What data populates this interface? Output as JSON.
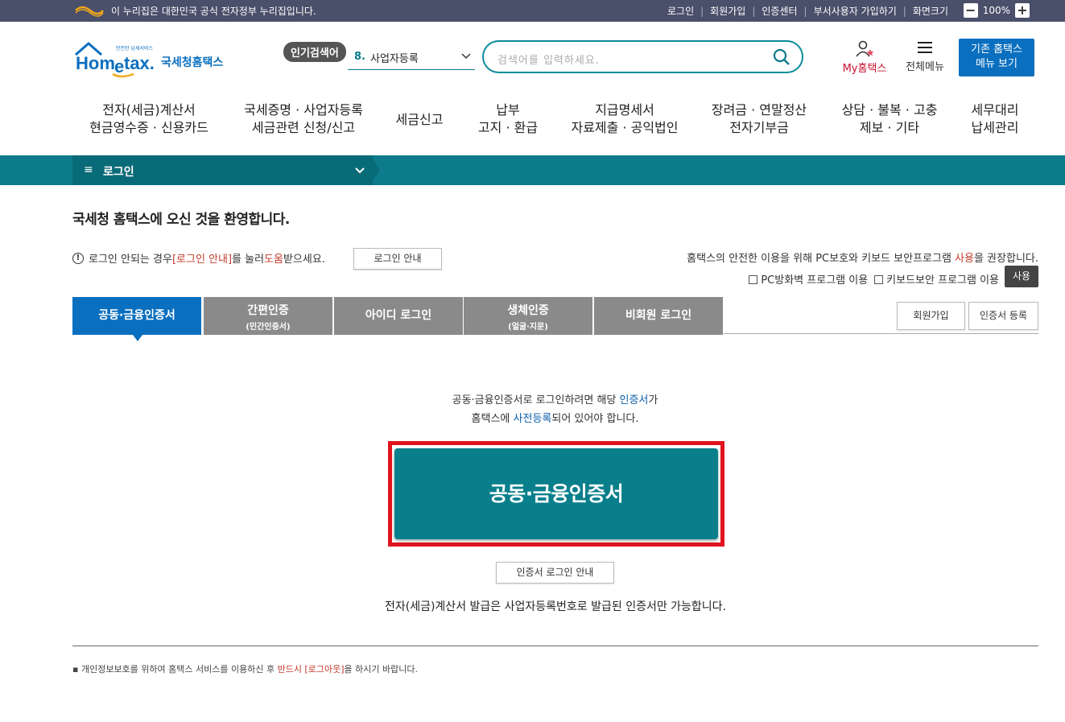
{
  "gov_bar": {
    "notice": "이 누리집은 대한민국 공식 전자정부 누리집입니다.",
    "links": [
      "로그인",
      "회원가입",
      "인증센터",
      "부서사용자 가입하기",
      "화면크기"
    ],
    "zoom_level": "100%"
  },
  "header": {
    "logo_main": "Hometax",
    "logo_sub": "국세청홈택스",
    "logo_tagline": "안전한 납세서비스",
    "popular_label": "인기검색어",
    "popular_num": "8.",
    "popular_value": "사업자등록",
    "search_placeholder": "검색어를 입력하세요.",
    "my_hometax": "My홈택스",
    "all_menu": "전체메뉴",
    "old_menu_line1": "기존 홈택스",
    "old_menu_line2": "메뉴 보기"
  },
  "gnb": [
    {
      "l1": "전자(세금)계산서",
      "l2": "현금영수증 · 신용카드"
    },
    {
      "l1": "국세증명 · 사업자등록",
      "l2": "세금관련 신청/신고"
    },
    {
      "l1": "세금신고",
      "l2": ""
    },
    {
      "l1": "납부",
      "l2": "고지 · 환급"
    },
    {
      "l1": "지급명세서",
      "l2": "자료제출 · 공익법인"
    },
    {
      "l1": "장려금 · 연말정산",
      "l2": "전자기부금"
    },
    {
      "l1": "상담 · 불복 · 고충",
      "l2": "제보 · 기타"
    },
    {
      "l1": "세무대리",
      "l2": "납세관리"
    }
  ],
  "location": {
    "label": "로그인"
  },
  "welcome": "국세청 홈택스에 오신 것을 환영합니다.",
  "help": {
    "prefix": "로그인 안되는 경우 ",
    "link": "[로그인 안내]",
    "middle": "를 눌러 ",
    "emph": "도움",
    "suffix": "받으세요.",
    "button": "로그인 안내"
  },
  "security": {
    "prefix": "홈택스의 안전한 이용을 위해 PC보호와 키보드 보안프로그램 ",
    "emph": "사용",
    "suffix": "을 권장합니다.",
    "opt1": "PC방화벽 프로그램 이용",
    "opt2": "키보드보안 프로그램 이용",
    "use_button": "사용"
  },
  "tabs": [
    {
      "label": "공동·금융인증서",
      "sub": ""
    },
    {
      "label": "간편인증",
      "sub": "(민간인증서)"
    },
    {
      "label": "아이디 로그인",
      "sub": ""
    },
    {
      "label": "생체인증",
      "sub": "(얼굴·지문)"
    },
    {
      "label": "비회원 로그인",
      "sub": ""
    }
  ],
  "side_buttons": {
    "join": "회원가입",
    "cert_register": "인증서 등록"
  },
  "cert_notice": {
    "line1_a": "공동·금융인증서로 로그인하려면 해당 ",
    "line1_b": "인증서",
    "line1_c": "가",
    "line2_a": "홈택스에 ",
    "line2_b": "사전등록",
    "line2_c": "되어 있어야 합니다."
  },
  "main_button": "공동·금융인증서",
  "cert_guide_button": "인증서 로그인 안내",
  "etax_notice": "전자(세금)계산서 발급은 사업자등록번호로 발급된 인증서만 가능합니다.",
  "footnote": {
    "a": "개인정보보호를 위하여 홈택스 서비스를 이용하신 후 ",
    "b": "반드시 [로그아웃]",
    "c": "을 하시기 바랍니다."
  },
  "colors": {
    "teal": "#0c7b8b",
    "active_tab": "#0a6fbf",
    "highlight": "#e0141e"
  }
}
